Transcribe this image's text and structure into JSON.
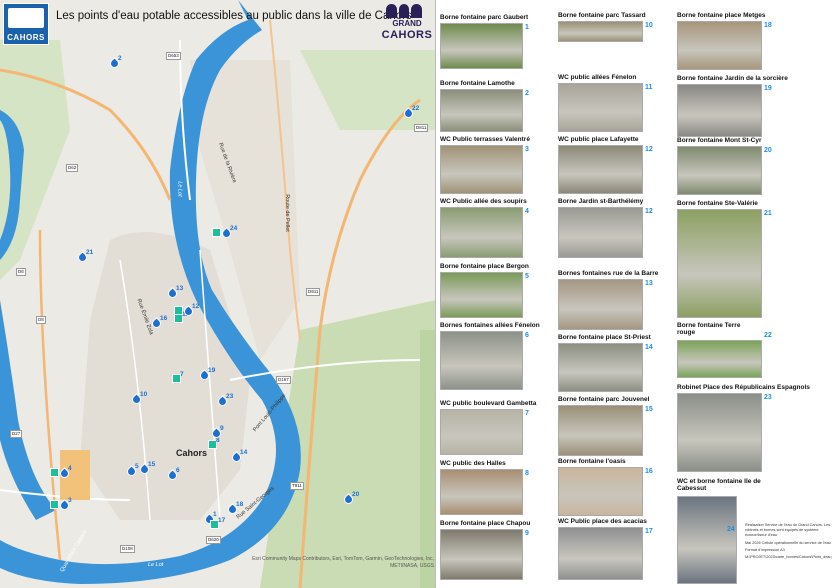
{
  "title": "Les points d'eau potable accessibles au public dans la ville de Cahors",
  "logos": {
    "cahors": "CAHORS",
    "grand_line1": "GRAND",
    "grand_line2": "CAHORS"
  },
  "colors": {
    "water_point": "#1f6fd1",
    "wc_point": "#1bbf9a",
    "river": "#3b94d8",
    "number": "#1f8ee0"
  },
  "map": {
    "city_label": "Cahors",
    "river_label": "Le Lot",
    "street_labels": [
      "Rue de la Rivière",
      "Route de Pellet",
      "Rue Émile Zola",
      "Pont Louis-Philippe",
      "Rue Saint-Georges",
      "Quai Albert Cappus"
    ],
    "road_tags": [
      "D653",
      "D811",
      "D62",
      "D8",
      "D6",
      "D27",
      "D911",
      "D167",
      "D108",
      "D620",
      "T911"
    ],
    "markers": [
      {
        "num": "1",
        "type": "water"
      },
      {
        "num": "2",
        "type": "water"
      },
      {
        "num": "3",
        "type": "both"
      },
      {
        "num": "4",
        "type": "both"
      },
      {
        "num": "5",
        "type": "water"
      },
      {
        "num": "6",
        "type": "water"
      },
      {
        "num": "7",
        "type": "wc"
      },
      {
        "num": "8",
        "type": "wc"
      },
      {
        "num": "9",
        "type": "water"
      },
      {
        "num": "10",
        "type": "water"
      },
      {
        "num": "11",
        "type": "wc"
      },
      {
        "num": "12",
        "type": "both"
      },
      {
        "num": "13",
        "type": "water"
      },
      {
        "num": "14",
        "type": "water"
      },
      {
        "num": "15",
        "type": "water"
      },
      {
        "num": "16",
        "type": "water"
      },
      {
        "num": "17",
        "type": "wc"
      },
      {
        "num": "18",
        "type": "water"
      },
      {
        "num": "19",
        "type": "water"
      },
      {
        "num": "20",
        "type": "water"
      },
      {
        "num": "21",
        "type": "water"
      },
      {
        "num": "22",
        "type": "water"
      },
      {
        "num": "23",
        "type": "water"
      },
      {
        "num": "24",
        "type": "both"
      }
    ],
    "attribution": "Esri Community Maps Contributors, Esri, TomTom, Garmin, GeoTechnologies, Inc, METI/NASA, USGS"
  },
  "points": [
    {
      "num": "1",
      "name": "Borne fontaine parc Gaubert"
    },
    {
      "num": "2",
      "name": "Borne fontaine Lamothe"
    },
    {
      "num": "3",
      "name": "WC Public terrasses Valentré"
    },
    {
      "num": "4",
      "name": "WC Public allée des soupirs"
    },
    {
      "num": "5",
      "name": "Borne fontaine place Bergon"
    },
    {
      "num": "6",
      "name": "Bornes fontaines allées Fénelon"
    },
    {
      "num": "7",
      "name": "WC public boulevard Gambetta"
    },
    {
      "num": "8",
      "name": "WC public des Halles"
    },
    {
      "num": "9",
      "name": "Borne fontaine place Chapou"
    },
    {
      "num": "10",
      "name": "Borne fontaine parc Tassard"
    },
    {
      "num": "11",
      "name": "WC public allées Fénelon"
    },
    {
      "num": "12",
      "name": "WC public place Lafayette"
    },
    {
      "num": "12",
      "name": "Borne Jardin st-Barthélémy"
    },
    {
      "num": "13",
      "name": "Bornes fontaines rue de la Barre"
    },
    {
      "num": "14",
      "name": "Borne fontaine place St-Priest"
    },
    {
      "num": "15",
      "name": "Borne fontaine parc Jouvenel"
    },
    {
      "num": "16",
      "name": "Borne fontaine l'oasis"
    },
    {
      "num": "17",
      "name": "WC Public place des acacias"
    },
    {
      "num": "18",
      "name": "Borne fontaine place Metges"
    },
    {
      "num": "19",
      "name": "Borne fontaine Jardin de la sorcière"
    },
    {
      "num": "20",
      "name": "Borne fontaine Mont St-Cyr"
    },
    {
      "num": "21",
      "name": "Borne fontaine Ste-Valérie"
    },
    {
      "num": "22",
      "name": "Borne fontaine Terre rouge"
    },
    {
      "num": "23",
      "name": "Robinet Place des Républicains Espagnols"
    },
    {
      "num": "24",
      "name": "WC et borne fontaine Ile de Cabessut"
    }
  ],
  "notes": [
    "Réalisation Service de l'eau du Grand Cahors. Les robinets et bornes sont équipés de système économiseur d'eau",
    "Mai 2026 Cellule opérationnelle du service de l'eau",
    "Format d'impression A3",
    "M:\\PROJET\\2023\\carte_bornes\\Cahors\\Point_deau_CAHORS"
  ]
}
